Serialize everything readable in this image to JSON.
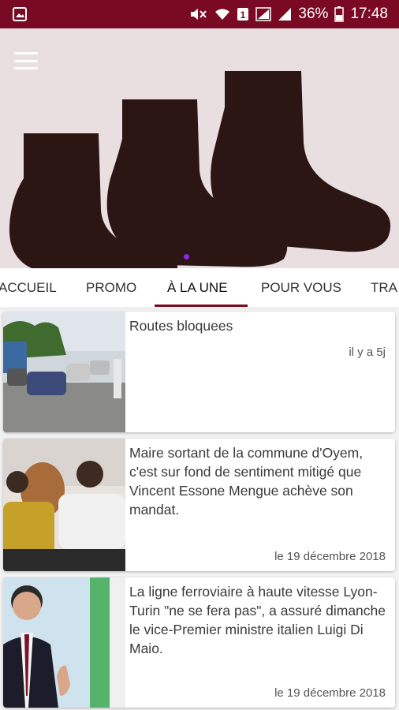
{
  "status_bar": {
    "icons": [
      "image-icon",
      "mute-icon",
      "wifi-icon",
      "sim1-icon",
      "signal-icon",
      "signal-icon",
      "battery-icon"
    ],
    "battery": "36%",
    "time": "17:48",
    "color": "#7a0a24"
  },
  "header": {
    "menu_icon": "hamburger-menu-icon"
  },
  "tabs": [
    {
      "label": "ACCUEIL"
    },
    {
      "label": "PROMO"
    },
    {
      "label": "À LA UNE",
      "active": true
    },
    {
      "label": "POUR VOUS"
    },
    {
      "label": "TRA"
    }
  ],
  "articles": [
    {
      "title": "Routes bloquees",
      "date": "il y a 5j"
    },
    {
      "title": "Maire sortant de la commune d'Oyem, c'est sur fond de sentiment mitigé que Vincent Essone Mengue achève son mandat.",
      "date": "le 19 décembre 2018"
    },
    {
      "title": "La ligne ferroviaire à haute vitesse Lyon-Turin \"ne se fera pas\", a assuré dimanche le vice-Premier ministre italien Luigi Di Maio.",
      "date": "le 19 décembre 2018"
    }
  ]
}
